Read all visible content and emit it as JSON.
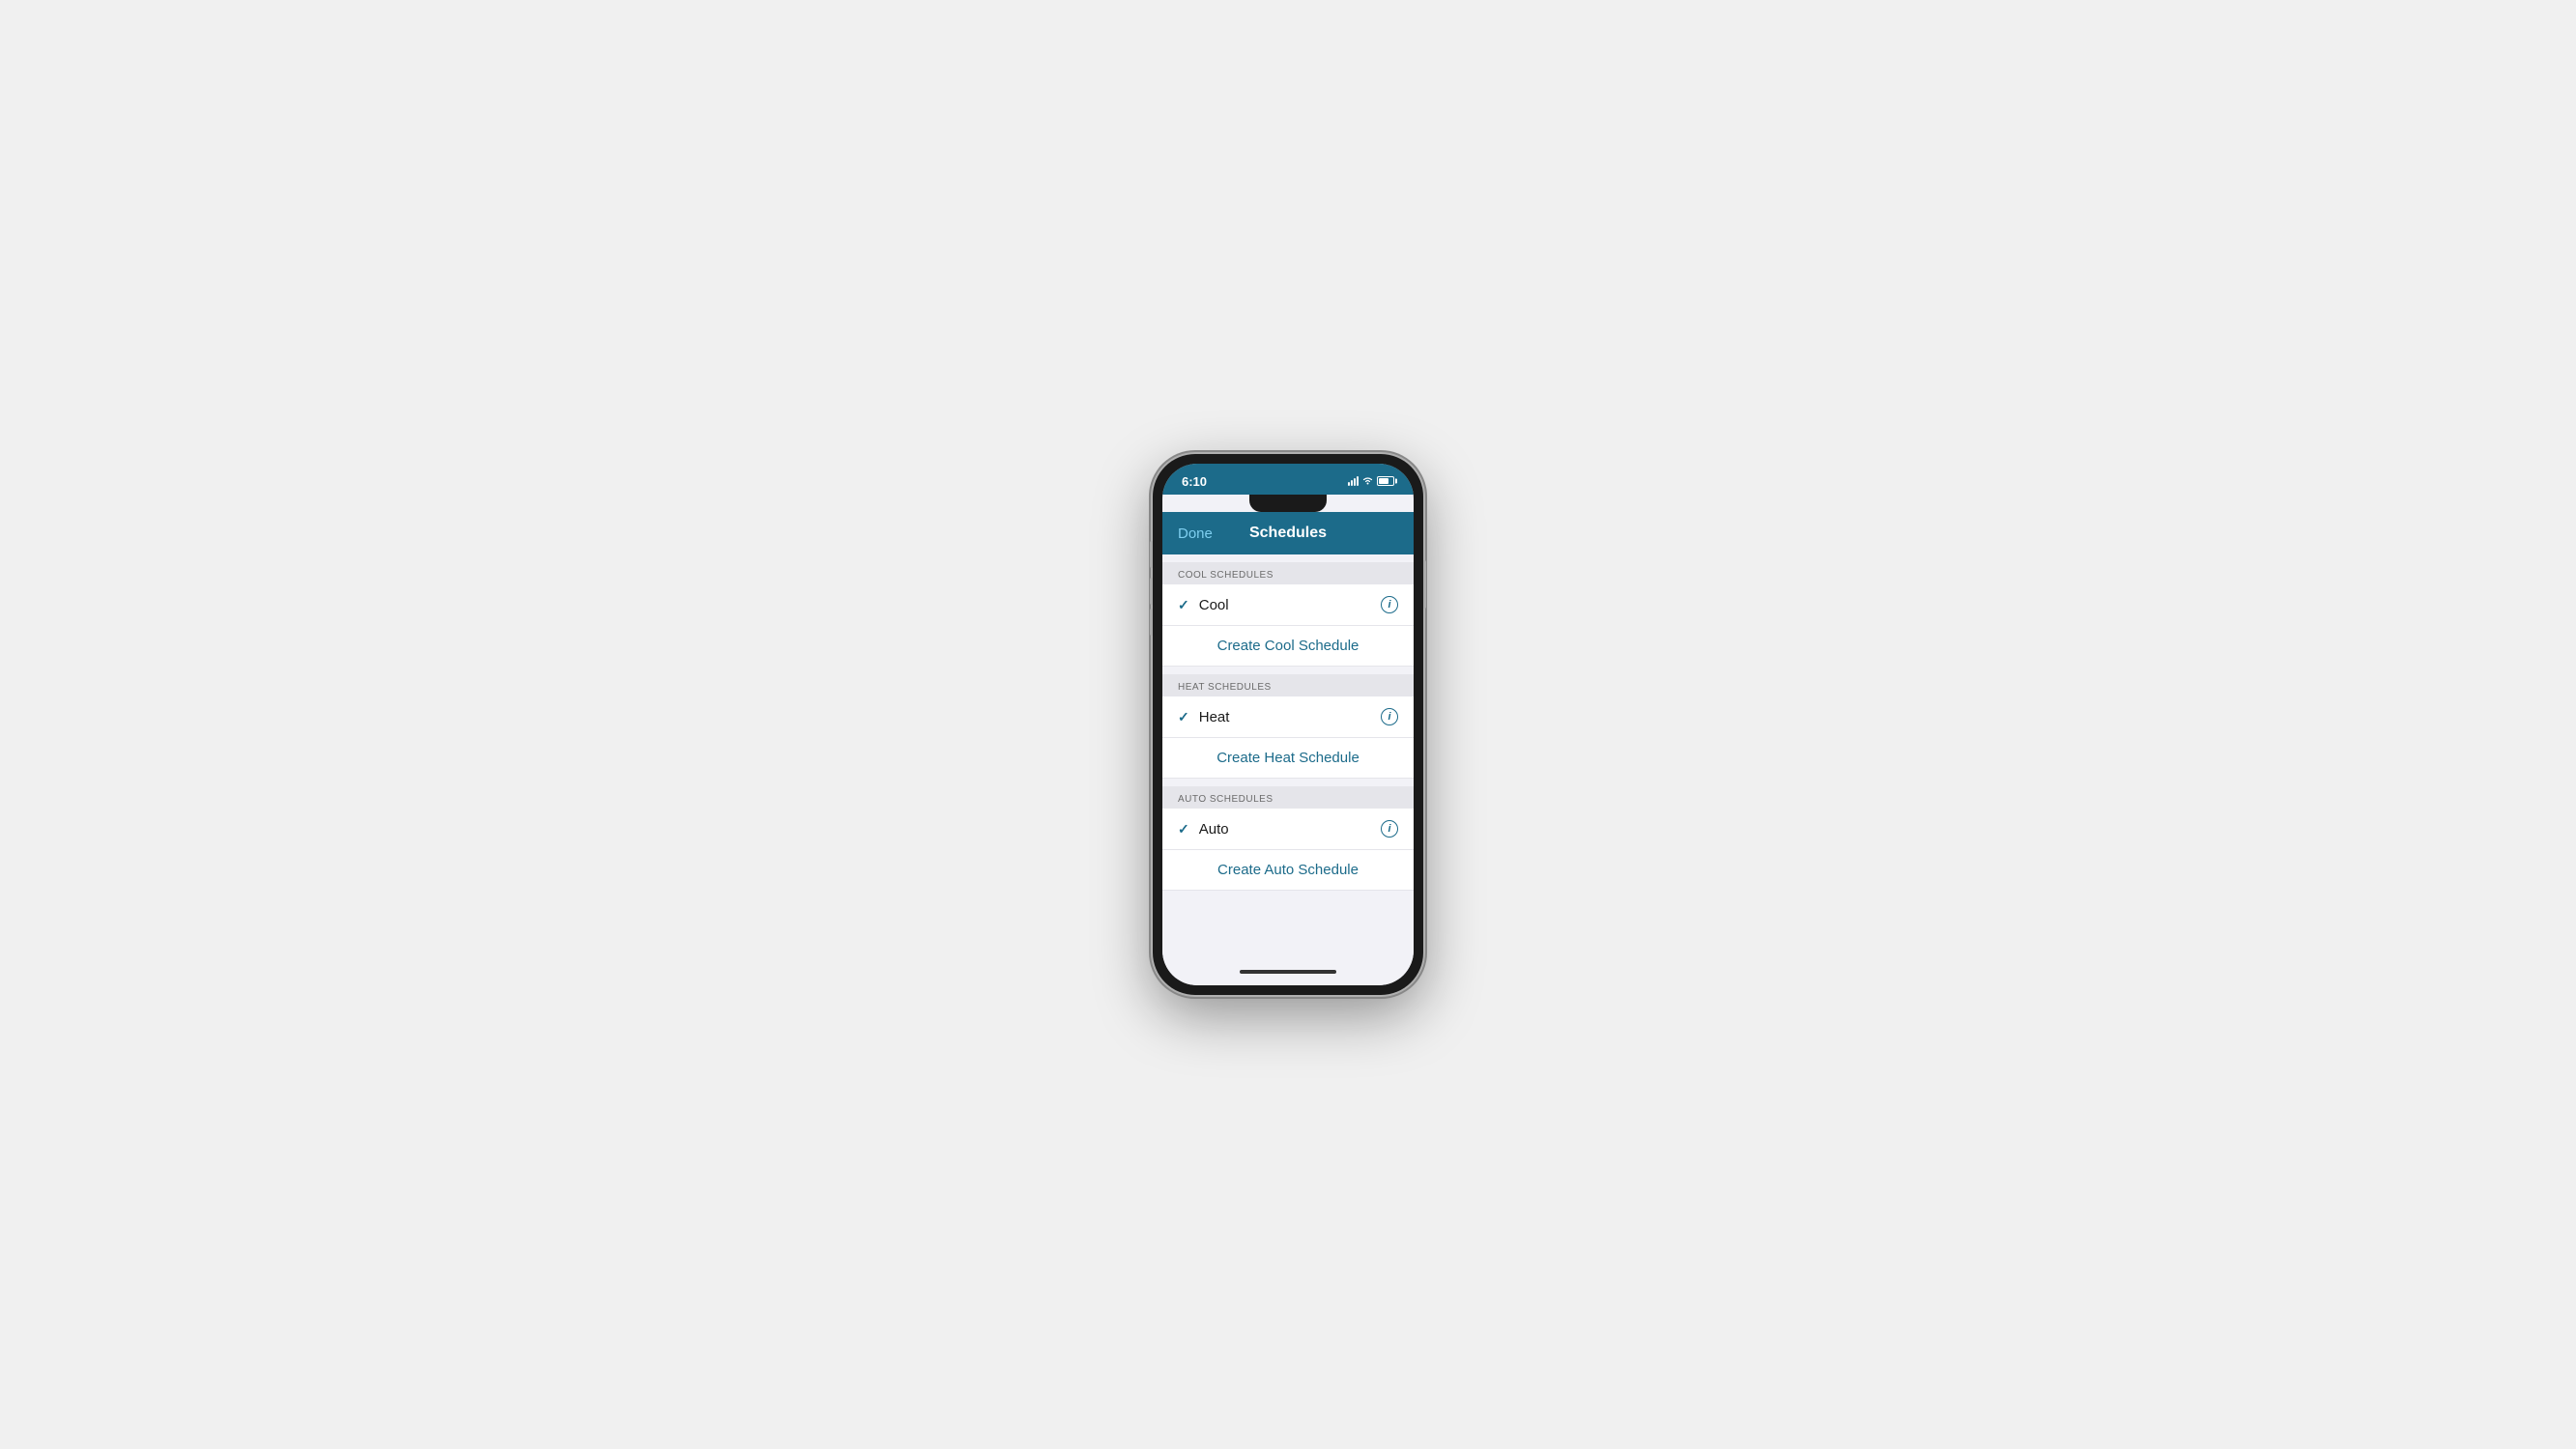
{
  "statusBar": {
    "time": "6:10",
    "batteryLevel": "70%"
  },
  "navBar": {
    "doneLabel": "Done",
    "title": "Schedules"
  },
  "sections": [
    {
      "id": "cool-schedules",
      "header": "COOL SCHEDULES",
      "items": [
        {
          "id": "cool",
          "label": "Cool",
          "checked": true,
          "showInfo": true
        }
      ],
      "createLabel": "Create Cool Schedule"
    },
    {
      "id": "heat-schedules",
      "header": "HEAT SCHEDULES",
      "items": [
        {
          "id": "heat",
          "label": "Heat",
          "checked": true,
          "showInfo": true
        }
      ],
      "createLabel": "Create Heat Schedule"
    },
    {
      "id": "auto-schedules",
      "header": "AUTO SCHEDULES",
      "items": [
        {
          "id": "auto",
          "label": "Auto",
          "checked": true,
          "showInfo": true
        }
      ],
      "createLabel": "Create Auto Schedule"
    }
  ],
  "icons": {
    "checkmark": "✓",
    "info": "i",
    "wifi": "▲",
    "battery": ""
  }
}
